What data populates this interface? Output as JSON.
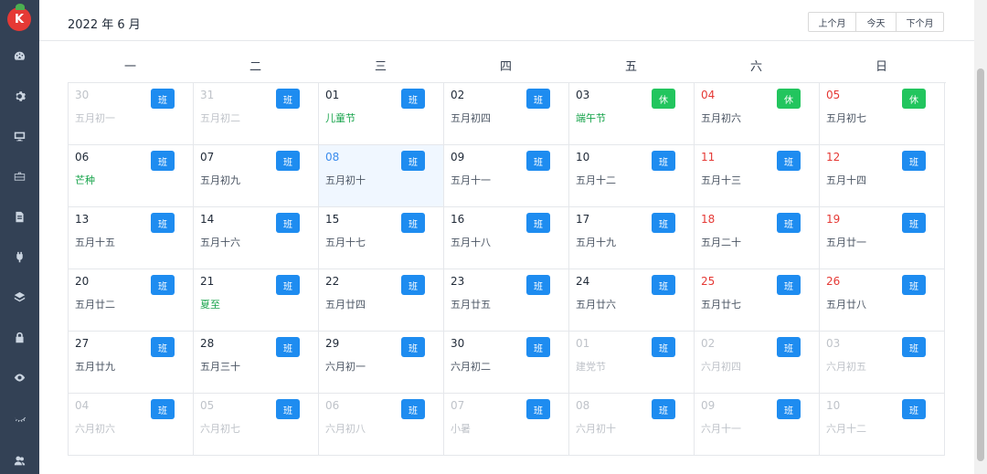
{
  "header": {
    "title": "2022 年 6 月",
    "prev_label": "上个月",
    "today_label": "今天",
    "next_label": "下个月"
  },
  "weekdays": [
    "一",
    "二",
    "三",
    "四",
    "五",
    "六",
    "日"
  ],
  "weeks": [
    [
      {
        "day": "30",
        "lunar": "五月初一",
        "badge": "班",
        "type": "work",
        "other": true
      },
      {
        "day": "31",
        "lunar": "五月初二",
        "badge": "班",
        "type": "work",
        "other": true
      },
      {
        "day": "01",
        "lunar": "儿童节",
        "festival": true,
        "badge": "班",
        "type": "work"
      },
      {
        "day": "02",
        "lunar": "五月初四",
        "badge": "班",
        "type": "work"
      },
      {
        "day": "03",
        "lunar": "端午节",
        "festival": true,
        "badge": "休",
        "type": "rest"
      },
      {
        "day": "04",
        "lunar": "五月初六",
        "badge": "休",
        "type": "rest",
        "weekend": true
      },
      {
        "day": "05",
        "lunar": "五月初七",
        "badge": "休",
        "type": "rest",
        "weekend": true
      }
    ],
    [
      {
        "day": "06",
        "lunar": "芒种",
        "festival": true,
        "badge": "班",
        "type": "work"
      },
      {
        "day": "07",
        "lunar": "五月初九",
        "badge": "班",
        "type": "work"
      },
      {
        "day": "08",
        "lunar": "五月初十",
        "badge": "班",
        "type": "work",
        "today": true
      },
      {
        "day": "09",
        "lunar": "五月十一",
        "badge": "班",
        "type": "work"
      },
      {
        "day": "10",
        "lunar": "五月十二",
        "badge": "班",
        "type": "work"
      },
      {
        "day": "11",
        "lunar": "五月十三",
        "badge": "班",
        "type": "work",
        "weekend": true
      },
      {
        "day": "12",
        "lunar": "五月十四",
        "badge": "班",
        "type": "work",
        "weekend": true
      }
    ],
    [
      {
        "day": "13",
        "lunar": "五月十五",
        "badge": "班",
        "type": "work"
      },
      {
        "day": "14",
        "lunar": "五月十六",
        "badge": "班",
        "type": "work"
      },
      {
        "day": "15",
        "lunar": "五月十七",
        "badge": "班",
        "type": "work"
      },
      {
        "day": "16",
        "lunar": "五月十八",
        "badge": "班",
        "type": "work"
      },
      {
        "day": "17",
        "lunar": "五月十九",
        "badge": "班",
        "type": "work"
      },
      {
        "day": "18",
        "lunar": "五月二十",
        "badge": "班",
        "type": "work",
        "weekend": true
      },
      {
        "day": "19",
        "lunar": "五月廿一",
        "badge": "班",
        "type": "work",
        "weekend": true
      }
    ],
    [
      {
        "day": "20",
        "lunar": "五月廿二",
        "badge": "班",
        "type": "work"
      },
      {
        "day": "21",
        "lunar": "夏至",
        "festival": true,
        "badge": "班",
        "type": "work"
      },
      {
        "day": "22",
        "lunar": "五月廿四",
        "badge": "班",
        "type": "work"
      },
      {
        "day": "23",
        "lunar": "五月廿五",
        "badge": "班",
        "type": "work"
      },
      {
        "day": "24",
        "lunar": "五月廿六",
        "badge": "班",
        "type": "work"
      },
      {
        "day": "25",
        "lunar": "五月廿七",
        "badge": "班",
        "type": "work",
        "weekend": true
      },
      {
        "day": "26",
        "lunar": "五月廿八",
        "badge": "班",
        "type": "work",
        "weekend": true
      }
    ],
    [
      {
        "day": "27",
        "lunar": "五月廿九",
        "badge": "班",
        "type": "work"
      },
      {
        "day": "28",
        "lunar": "五月三十",
        "badge": "班",
        "type": "work"
      },
      {
        "day": "29",
        "lunar": "六月初一",
        "badge": "班",
        "type": "work"
      },
      {
        "day": "30",
        "lunar": "六月初二",
        "badge": "班",
        "type": "work"
      },
      {
        "day": "01",
        "lunar": "建党节",
        "badge": "班",
        "type": "work",
        "other": true
      },
      {
        "day": "02",
        "lunar": "六月初四",
        "badge": "班",
        "type": "work",
        "other": true
      },
      {
        "day": "03",
        "lunar": "六月初五",
        "badge": "班",
        "type": "work",
        "other": true
      }
    ],
    [
      {
        "day": "04",
        "lunar": "六月初六",
        "badge": "班",
        "type": "work",
        "other": true
      },
      {
        "day": "05",
        "lunar": "六月初七",
        "badge": "班",
        "type": "work",
        "other": true
      },
      {
        "day": "06",
        "lunar": "六月初八",
        "badge": "班",
        "type": "work",
        "other": true
      },
      {
        "day": "07",
        "lunar": "小暑",
        "badge": "班",
        "type": "work",
        "other": true
      },
      {
        "day": "08",
        "lunar": "六月初十",
        "badge": "班",
        "type": "work",
        "other": true
      },
      {
        "day": "09",
        "lunar": "六月十一",
        "badge": "班",
        "type": "work",
        "other": true
      },
      {
        "day": "10",
        "lunar": "六月十二",
        "badge": "班",
        "type": "work",
        "other": true
      }
    ]
  ],
  "sidebar_icons": [
    "dashboard-icon",
    "gear-icon",
    "monitor-icon",
    "briefcase-icon",
    "document-icon",
    "plugin-icon",
    "layers-icon",
    "lock-icon",
    "eye-icon",
    "eye-closed-icon",
    "users-icon"
  ],
  "colors": {
    "sidebar": "#334155",
    "work_badge": "#1e8cf0",
    "rest_badge": "#22c55e",
    "weekend_day": "#e53935",
    "festival": "#16a34a"
  }
}
